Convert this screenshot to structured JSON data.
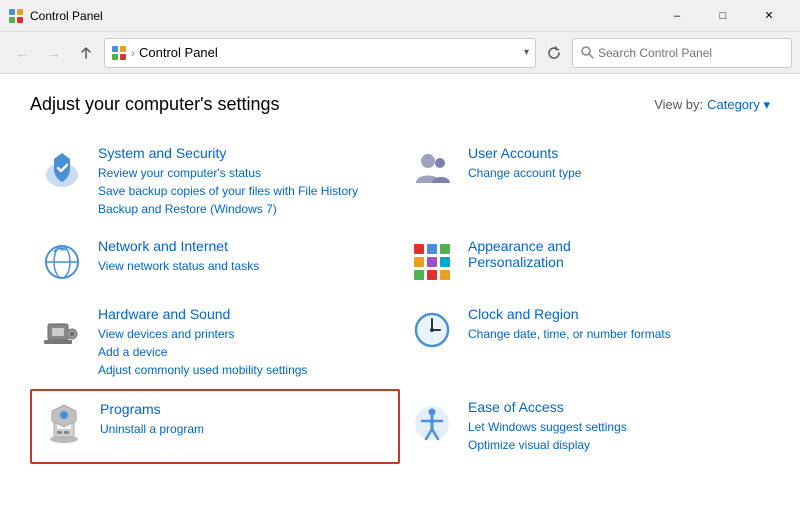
{
  "titleBar": {
    "icon": "control-panel",
    "title": "Control Panel",
    "minimizeLabel": "–",
    "maximizeLabel": "□",
    "closeLabel": "✕"
  },
  "addressBar": {
    "backLabel": "←",
    "forwardLabel": "→",
    "upLabel": "↑",
    "addressPath": "Control Panel",
    "refreshLabel": "↻",
    "searchPlaceholder": "Search Control Panel"
  },
  "main": {
    "title": "Adjust your computer's settings",
    "viewBy": "View by:",
    "viewByValue": "Category ▾",
    "categories": [
      {
        "id": "system-security",
        "title": "System and Security",
        "links": [
          "Review your computer's status",
          "Save backup copies of your files with File History",
          "Backup and Restore (Windows 7)"
        ],
        "highlighted": false
      },
      {
        "id": "user-accounts",
        "title": "User Accounts",
        "links": [
          "Change account type"
        ],
        "highlighted": false
      },
      {
        "id": "network-internet",
        "title": "Network and Internet",
        "links": [
          "View network status and tasks"
        ],
        "highlighted": false
      },
      {
        "id": "appearance-personalization",
        "title": "Appearance and Personalization",
        "links": [],
        "highlighted": false
      },
      {
        "id": "hardware-sound",
        "title": "Hardware and Sound",
        "links": [
          "View devices and printers",
          "Add a device",
          "Adjust commonly used mobility settings"
        ],
        "highlighted": false
      },
      {
        "id": "clock-region",
        "title": "Clock and Region",
        "links": [
          "Change date, time, or number formats"
        ],
        "highlighted": false
      },
      {
        "id": "programs",
        "title": "Programs",
        "links": [
          "Uninstall a program"
        ],
        "highlighted": true
      },
      {
        "id": "ease-of-access",
        "title": "Ease of Access",
        "links": [
          "Let Windows suggest settings",
          "Optimize visual display"
        ],
        "highlighted": false
      }
    ]
  }
}
